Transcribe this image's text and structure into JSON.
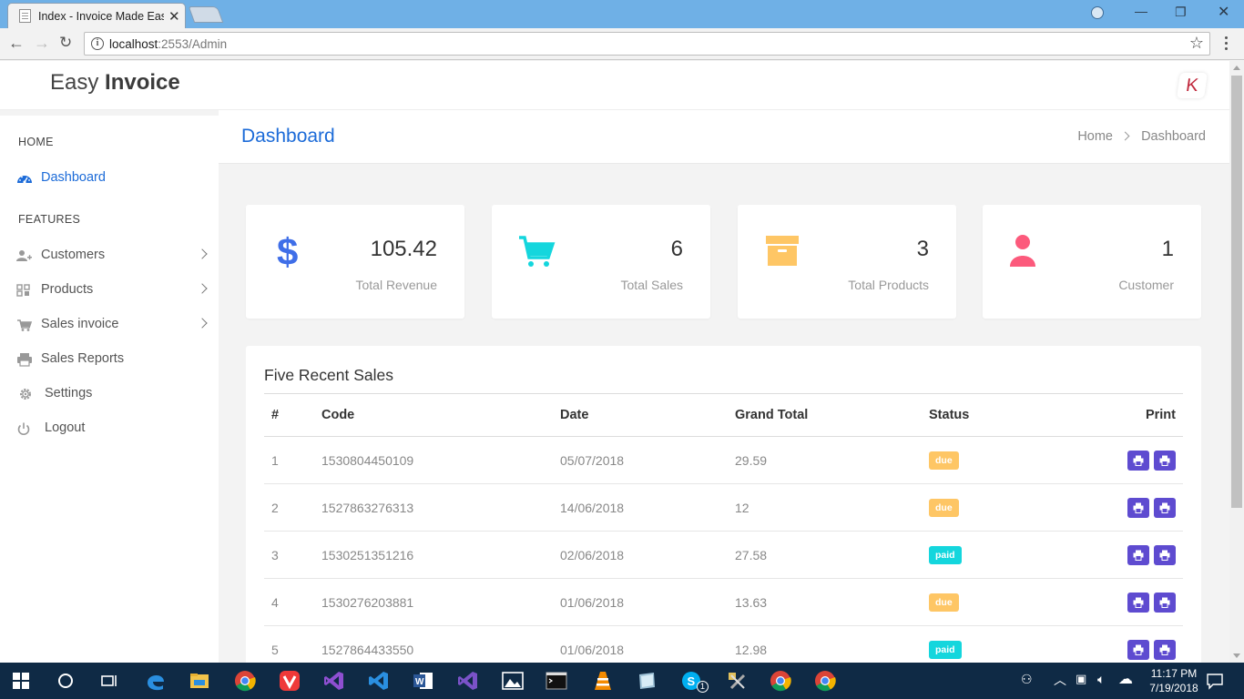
{
  "browser": {
    "tab_title": "Index - Invoice Made Eas",
    "url_host": "localhost",
    "url_rest": ":2553/Admin"
  },
  "app": {
    "brand_light": "Easy ",
    "brand_bold": "Invoice",
    "user_initial": "K"
  },
  "sidebar": {
    "section_home": "HOME",
    "section_features": "FEATURES",
    "items": [
      {
        "label": "Dashboard",
        "icon": "dashboard-icon"
      },
      {
        "label": "Customers",
        "icon": "users-icon"
      },
      {
        "label": "Products",
        "icon": "grid-icon"
      },
      {
        "label": "Sales invoice",
        "icon": "cart-icon"
      },
      {
        "label": "Sales Reports",
        "icon": "printer-icon"
      },
      {
        "label": "Settings",
        "icon": "gear-icon"
      },
      {
        "label": "Logout",
        "icon": "power-icon"
      }
    ]
  },
  "page": {
    "title": "Dashboard",
    "breadcrumb": [
      "Home",
      "Dashboard"
    ]
  },
  "stats": [
    {
      "value": "105.42",
      "label": "Total Revenue",
      "icon": "dollar-icon",
      "color": "#3f6ee8"
    },
    {
      "value": "6",
      "label": "Total Sales",
      "icon": "cart-icon",
      "color": "#14d6dd"
    },
    {
      "value": "3",
      "label": "Total Products",
      "icon": "box-icon",
      "color": "#fec665"
    },
    {
      "value": "1",
      "label": "Customer",
      "icon": "user-icon",
      "color": "#fc5a7c"
    }
  ],
  "recent_sales": {
    "title": "Five Recent Sales",
    "columns": [
      "#",
      "Code",
      "Date",
      "Grand Total",
      "Status",
      "Print"
    ],
    "rows": [
      {
        "n": "1",
        "code": "1530804450109",
        "date": "05/07/2018",
        "total": "29.59",
        "status": "due"
      },
      {
        "n": "2",
        "code": "1527863276313",
        "date": "14/06/2018",
        "total": "12",
        "status": "due"
      },
      {
        "n": "3",
        "code": "1530251351216",
        "date": "02/06/2018",
        "total": "27.58",
        "status": "paid"
      },
      {
        "n": "4",
        "code": "1530276203881",
        "date": "01/06/2018",
        "total": "13.63",
        "status": "due"
      },
      {
        "n": "5",
        "code": "1527864433550",
        "date": "01/06/2018",
        "total": "12.98",
        "status": "paid"
      }
    ]
  },
  "taskbar": {
    "time": "11:17 PM",
    "date": "7/19/2018",
    "skype_badge": "1"
  },
  "colors": {
    "accent": "#1c6bd8",
    "print_button": "#5e4bd0",
    "due": "#fec665",
    "paid": "#14d6dd"
  }
}
